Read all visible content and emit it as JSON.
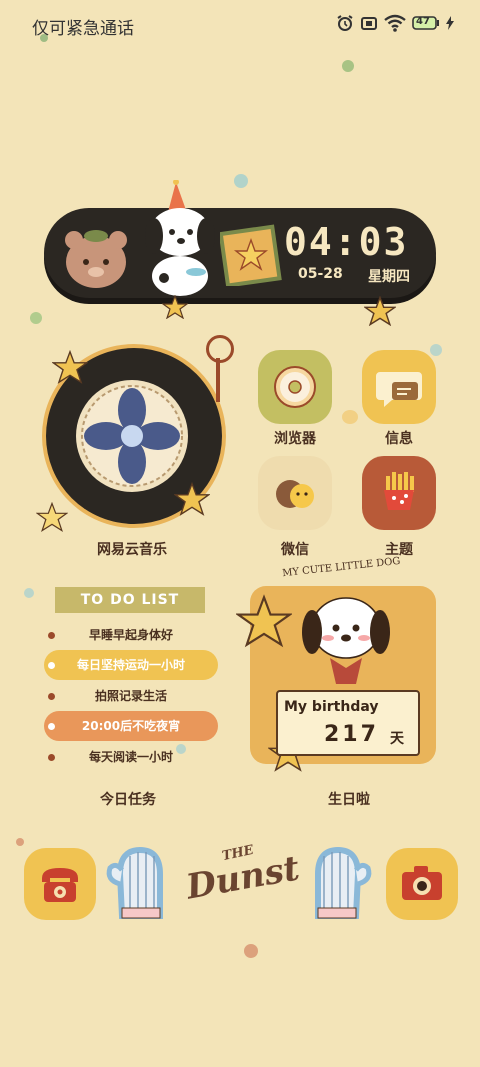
{
  "status_bar": {
    "carrier_text": "仅可紧急通话",
    "battery_level": "47",
    "icons": [
      "alarm-icon",
      "sim-card-icon",
      "wifi-icon",
      "battery-icon",
      "charging-icon"
    ]
  },
  "clock_widget": {
    "time": "04:03",
    "date": "05-28",
    "weekday": "星期四"
  },
  "apps": {
    "music": "网易云音乐",
    "browser": "浏览器",
    "messages": "信息",
    "wechat": "微信",
    "theme": "主题"
  },
  "todo_widget": {
    "title": "TO DO LIST",
    "items": [
      "早睡早起身体好",
      "每日坚持运动一小时",
      "拍照记录生活",
      "20:00后不吃夜宵",
      "每天阅读一小时"
    ],
    "label": "今日任务"
  },
  "birthday_widget": {
    "caption": "MY CUTE LITTLE DOG",
    "title": "My birthday",
    "days": "217",
    "unit": "天",
    "label": "生日啦"
  },
  "dock": {
    "brand_small": "THE",
    "brand_big": "Dunst",
    "items": [
      "phone-icon",
      "camera-icon"
    ]
  },
  "colors": {
    "background": "#f3e4b8",
    "accent_orange": "#e9a25a",
    "accent_yellow": "#f0c352",
    "dark": "#2b2722",
    "text": "#4a3020"
  }
}
